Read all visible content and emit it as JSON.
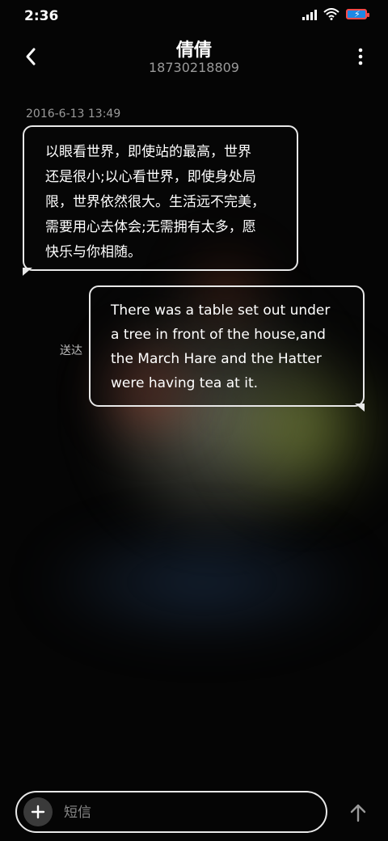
{
  "status_bar": {
    "time": "2:36",
    "icons": [
      "signal-icon",
      "wifi-icon",
      "battery-charging-icon"
    ]
  },
  "header": {
    "contact_name": "倩倩",
    "phone_number": "18730218809",
    "icons": [
      "back-arrow-icon",
      "more-vert-icon"
    ]
  },
  "conversation": {
    "timestamp": "2016-6-13 13:49",
    "incoming": {
      "lines": [
        "以眼看世界，即使站的最高，世界",
        "还是很小;以心看世界，即使身处局",
        "限，世界依然很大。生活远不完美，",
        "需要用心去体会;无需拥有太多，愿",
        "快乐与你相随。"
      ]
    },
    "outgoing": {
      "lines": [
        "There was a table set out under",
        "a tree in front of the house,and",
        "the March Hare and the Hatter",
        "were having tea at it."
      ],
      "status": "送达"
    }
  },
  "composer": {
    "placeholder": "短信",
    "icons": [
      "plus-icon",
      "send-arrow-icon"
    ]
  },
  "colors": {
    "background": "#050505",
    "bubble_border": "#e8e8e8",
    "secondary_text": "#9a9a9a"
  }
}
